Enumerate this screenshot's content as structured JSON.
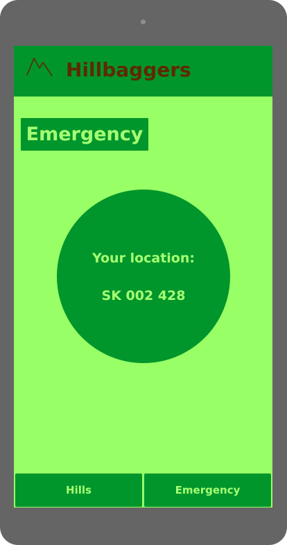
{
  "app": {
    "title": "Hillbaggers",
    "logo_icon": "mountain-icon"
  },
  "page": {
    "heading": "Emergency"
  },
  "location": {
    "label": "Your location:",
    "grid_reference": "SK 002 428"
  },
  "nav": {
    "items": [
      {
        "label": "Hills"
      },
      {
        "label": "Emergency"
      }
    ]
  },
  "colors": {
    "background": "#99ff66",
    "primary": "#00962c",
    "accent_text": "#a6ff73",
    "title_text": "#5e2a00",
    "device_frame": "#656565"
  }
}
